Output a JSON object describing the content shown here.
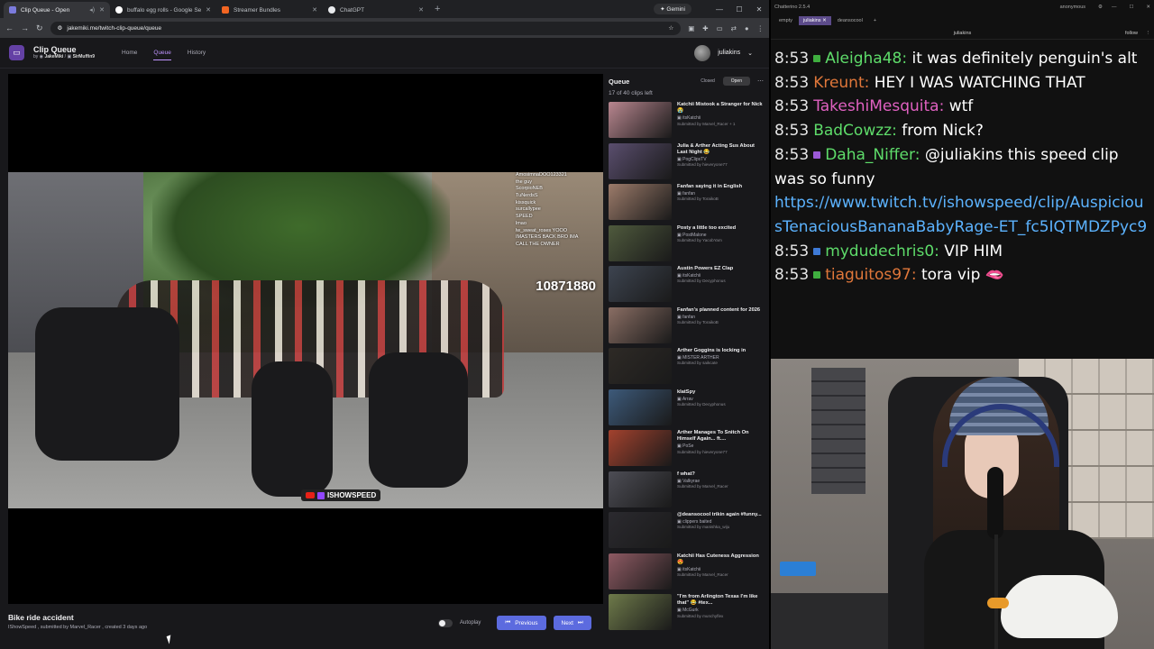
{
  "browser": {
    "tabs": [
      {
        "title": "Clip Queue - Open",
        "active": true,
        "favicon_color": "#7b7bdc"
      },
      {
        "title": "buffalo egg rolls - Google Sear",
        "active": false,
        "favicon_color": "#ffffff"
      },
      {
        "title": "Streamer Bundles",
        "active": false,
        "favicon_color": "#f26522"
      },
      {
        "title": "ChatGPT",
        "active": false,
        "favicon_color": "#e8eaed"
      }
    ],
    "new_tab": "+",
    "gemini_label": "Gemini",
    "url": "jakemiki.me/twitch-clip-queue/queue"
  },
  "app": {
    "title": "Clip Queue",
    "by_prefix": "by",
    "author1": "JakeMiki",
    "author2": "SirMuffin9",
    "nav": [
      {
        "label": "Home",
        "active": false
      },
      {
        "label": "Queue",
        "active": true
      },
      {
        "label": "History",
        "active": false
      }
    ],
    "username": "juliakins",
    "video": {
      "overlay_count": "10871880",
      "watermark": "ISHOWSPEED",
      "overlay_chat": [
        "AmosimnaDOO123321",
        "the guy",
        "ScorpioNEB",
        "TuNerdsS",
        "kissquick",
        "surcallypee",
        "SPEED",
        "lmao",
        "lw_sweat_roses  YOOO",
        "IMASTERS BACK BRO IMA",
        "CALL THE OWNER"
      ]
    },
    "current_clip": {
      "title": "Bike ride accident",
      "channel": "IShowSpeed",
      "submitted_by_prefix": "submitted by",
      "submitter": "Marvel_Racer",
      "created": "created 3 days ago"
    },
    "autoplay_label": "Autoplay",
    "prev_label": "Previous",
    "next_label": "Next",
    "queue": {
      "title": "Queue",
      "closed_label": "Closed",
      "open_label": "Open",
      "count_text": "17 of 40 clips left",
      "clips": [
        {
          "title": "Katchii Mistook a Stranger for Nick 😭",
          "channel": "itsKatchii",
          "submitted": "Submitted by Marvel_Racer + 1",
          "color": "#b8868f"
        },
        {
          "title": "Julia & Arther Acting Sus About Last Night 😂",
          "channel": "PogClipsTV",
          "submitted": "Submitted by hieveryone77",
          "color": "#5a4e6e"
        },
        {
          "title": "Fanfan saying it in English",
          "channel": "fanfan",
          "submitted": "Submitted by ToraikoB",
          "color": "#9c7b6a"
        },
        {
          "title": "Posty a little too excited",
          "channel": "PostMalone",
          "submitted": "Submitted by YacobYam",
          "color": "#4f5a3d"
        },
        {
          "title": "Austin Powers EZ Clap",
          "channel": "itsKatchii",
          "submitted": "Submitted by Decyphonus",
          "color": "#3d4450"
        },
        {
          "title": "Fanfan's planned content for 2026",
          "channel": "fanfan",
          "submitted": "Submitted by ToraikoB",
          "color": "#8a6e64"
        },
        {
          "title": "Arther Goggins is locking in",
          "channel": "MISTER ARTHER",
          "submitted": "Submitted by saikcate",
          "color": "#2e2a26"
        },
        {
          "title": "kIatSpy",
          "channel": "Arrav",
          "submitted": "Submitted by Decyphonus",
          "color": "#3d5a7a"
        },
        {
          "title": "Arther Manages To Snitch On Himself Again... ft....",
          "channel": "PoSe",
          "submitted": "Submitted by hieveryone77",
          "color": "#a3422e"
        },
        {
          "title": "f what?",
          "channel": "Valkyrae",
          "submitted": "Submitted by Marvel_Racer",
          "color": "#4d4d55"
        },
        {
          "title": "@deansocool trikin again #funny...",
          "channel": "clippers baited",
          "submitted": "Submitted by manishka_wiju",
          "color": "#2b2a2f"
        },
        {
          "title": "Katchii Has Cuteness Aggression 😍",
          "channel": "itsKatchii",
          "submitted": "Submitted by Marvel_Racer",
          "color": "#8e5a63"
        },
        {
          "title": "\"I'm from Arlington Texas I'm like that\" 😂 #tex...",
          "channel": "McGurk",
          "submitted": "Submitted by munchyflex",
          "color": "#6e7a4a"
        }
      ]
    }
  },
  "chatterino": {
    "title": "Chatterino 2.5.4",
    "account": "anonymous",
    "tabs": [
      {
        "label": "empty",
        "active": false
      },
      {
        "label": "juliakins",
        "active": true
      },
      {
        "label": "deansocool",
        "active": false
      }
    ],
    "channel": "juliakins",
    "follow_label": "follow",
    "messages": [
      {
        "time": "8:53",
        "user": "Aleigha48",
        "color": "#5edc6a",
        "badge_color": "#3fae3f",
        "text": "it was definitely penguin's alt"
      },
      {
        "time": "8:53",
        "user": "Kreunt",
        "color": "#e0773a",
        "badge_color": "",
        "text": "HEY I WAS WATCHING THAT"
      },
      {
        "time": "8:53",
        "user": "TakeshiMesquita",
        "color": "#e061c1",
        "badge_color": "",
        "text": "wtf"
      },
      {
        "time": "8:53",
        "user": "BadCowzz",
        "color": "#5edc6a",
        "badge_color": "",
        "text": "from Nick?"
      },
      {
        "time": "8:53",
        "user": "Daha_Niffer",
        "color": "#5edc6a",
        "badge_color": "#9b59d6",
        "text": "@juliakins this speed clip was so funny"
      },
      {
        "time": "",
        "user": "",
        "color": "",
        "badge_color": "",
        "link": "https://www.twitch.tv/ishowspeed/clip/AuspiciousTenaciousBananaBabyRage-ET_fc5IQTMDZPyc9"
      },
      {
        "time": "8:53",
        "user": "mydudechris0",
        "color": "#5edc6a",
        "badge_color": "#3e7ad6",
        "text": "VIP HIM"
      },
      {
        "time": "8:53",
        "user": "tiaguitos97",
        "color": "#e0773a",
        "badge_color": "#3fae3f",
        "text": "tora vip 🫦"
      }
    ],
    "window_controls": [
      "—",
      "☐",
      "✕"
    ]
  }
}
